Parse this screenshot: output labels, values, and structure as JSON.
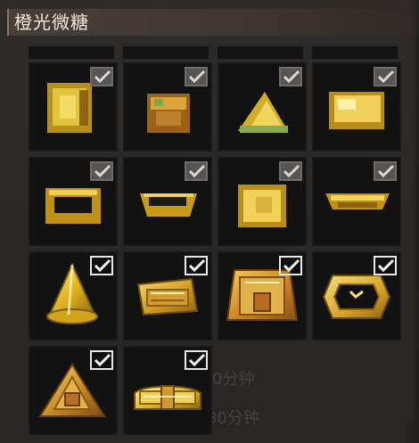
{
  "panel": {
    "title": "橙光微糖"
  },
  "ghost_text": [
    "0分钟",
    "30分钟"
  ],
  "items": [
    {
      "name": "locked-item-box",
      "icon": "pixel-box-icon",
      "checked": true,
      "revealed": false
    },
    {
      "name": "locked-item-cake",
      "icon": "pixel-cake-icon",
      "checked": true,
      "revealed": false
    },
    {
      "name": "locked-item-wedge",
      "icon": "pixel-wedge-icon",
      "checked": true,
      "revealed": false
    },
    {
      "name": "locked-item-tray",
      "icon": "pixel-tray-icon",
      "checked": true,
      "revealed": false
    },
    {
      "name": "locked-item-frame",
      "icon": "pixel-frame-icon",
      "checked": true,
      "revealed": false
    },
    {
      "name": "locked-item-bowl",
      "icon": "pixel-bowl-icon",
      "checked": true,
      "revealed": false
    },
    {
      "name": "locked-item-cube",
      "icon": "pixel-cube-icon",
      "checked": true,
      "revealed": false
    },
    {
      "name": "locked-item-plate",
      "icon": "pixel-plate-icon",
      "checked": true,
      "revealed": false
    },
    {
      "name": "golden-cone",
      "icon": "golden-cone-icon",
      "checked": true,
      "revealed": true
    },
    {
      "name": "golden-bar",
      "icon": "golden-bar-icon",
      "checked": true,
      "revealed": true
    },
    {
      "name": "golden-box",
      "icon": "golden-box-icon",
      "checked": true,
      "revealed": true
    },
    {
      "name": "golden-frame",
      "icon": "golden-frame-icon",
      "checked": true,
      "revealed": true
    },
    {
      "name": "golden-pyramid",
      "icon": "golden-pyramid-icon",
      "checked": true,
      "revealed": true
    },
    {
      "name": "golden-bridge",
      "icon": "golden-bridge-icon",
      "checked": true,
      "revealed": true
    }
  ],
  "colors": {
    "gold": "#d9a91b",
    "gold_light": "#f2d35a",
    "gold_dark": "#8d6411",
    "orange": "#c8742a"
  }
}
